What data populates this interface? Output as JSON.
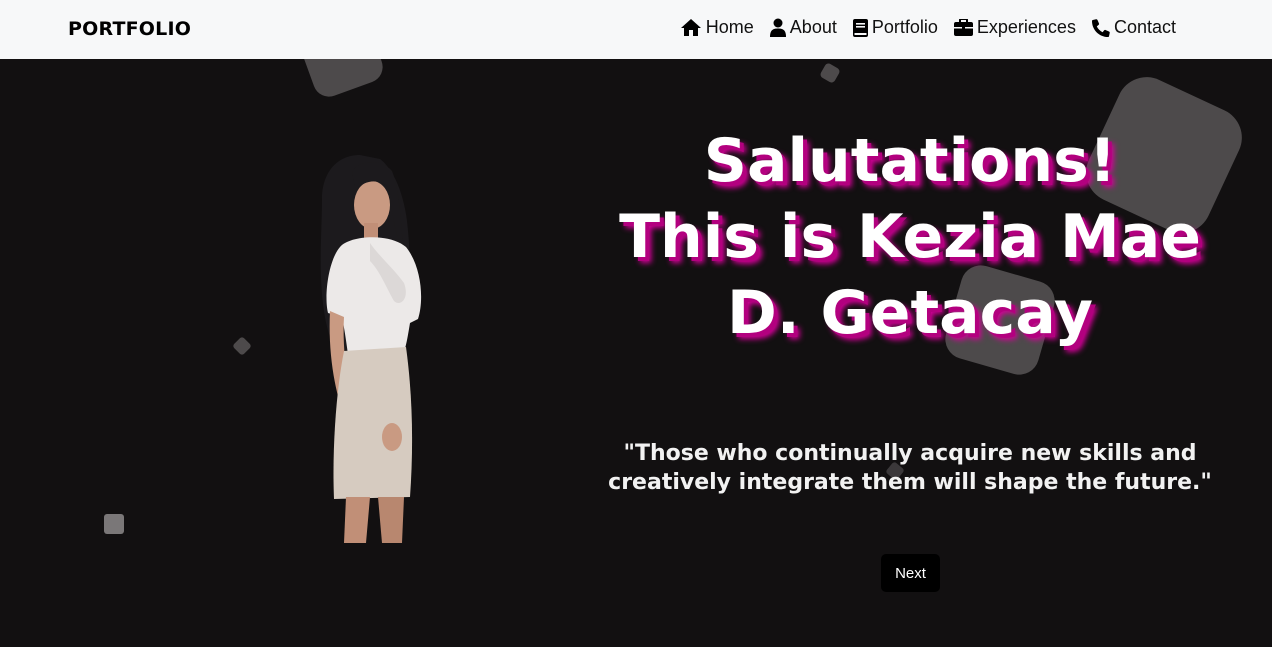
{
  "navbar": {
    "brand": "PORTFOLIO",
    "items": [
      {
        "label": "Home",
        "icon": "home-icon"
      },
      {
        "label": "About",
        "icon": "user-icon"
      },
      {
        "label": "Portfolio",
        "icon": "book-icon"
      },
      {
        "label": "Experiences",
        "icon": "briefcase-icon"
      },
      {
        "label": "Contact",
        "icon": "phone-icon"
      }
    ]
  },
  "hero": {
    "heading_line1": "Salutations!",
    "heading_line2": "This is Kezia Mae",
    "heading_line3": "D. Getacay",
    "quote_line1": "\"Those who continually acquire new skills and",
    "quote_line2": "creatively integrate them will shape the future.\"",
    "next_label": "Next"
  },
  "colors": {
    "background": "#121011",
    "navbar": "#f7f8f9",
    "heading_glow": "#d6009a",
    "shapes": "#4d4a4b"
  }
}
